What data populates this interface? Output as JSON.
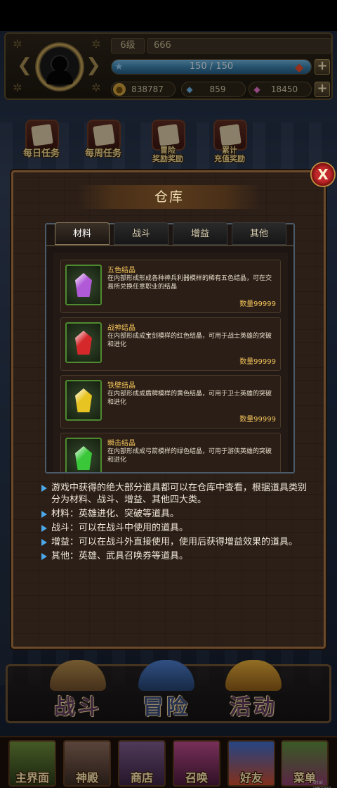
{
  "header": {
    "level": "6级",
    "player_name": "666",
    "stamina": {
      "text": "150 / 150",
      "fraction": 1.0
    },
    "gold": "838787",
    "crystal": "859",
    "diamond": "18450"
  },
  "quests": [
    {
      "label": "每日任务"
    },
    {
      "label": "每周任务"
    },
    {
      "label": "冒险\n奖励奖励"
    },
    {
      "label": "累计\n充值奖励"
    }
  ],
  "modal": {
    "title": "仓库",
    "close_label": "X",
    "tabs": [
      "材料",
      "战斗",
      "增益",
      "其他"
    ],
    "active_tab": 0,
    "items": [
      {
        "name": "五色结晶",
        "desc": "在内部形成形成各种神兵利器模样的稀有五色结晶，可在交易所兑换任意职业的结晶",
        "qty": "数量99999",
        "color": "#b05ad8"
      },
      {
        "name": "战神结晶",
        "desc": "在内部形成成宝剑模样的红色结晶，可用于战士英雄的突破和进化",
        "qty": "数量99999",
        "color": "#d4282a"
      },
      {
        "name": "铁壁结晶",
        "desc": "在内部形成成盾牌模样的黄色结晶，可用于卫士英雄的突破和进化",
        "qty": "数量99999",
        "color": "#e8c422"
      },
      {
        "name": "瞬击结晶",
        "desc": "在内部形成成弓箭模样的绿色结晶，可用于游侠英雄的突破和进化",
        "qty": "",
        "color": "#3ac83a"
      }
    ],
    "help": [
      "游戏中获得的绝大部分道具都可以在仓库中查看，根据道具类别分为材料、战斗、增益、其他四大类。",
      "材料：英雄进化、突破等道具。",
      "战斗：可以在战斗中使用的道具。",
      "增益：可以在战斗外直接使用，使用后获得增益效果的道具。",
      "其他：英雄、武具召唤券等道具。"
    ]
  },
  "big_nav": [
    {
      "label": "战斗"
    },
    {
      "label": "冒险"
    },
    {
      "label": "活动"
    }
  ],
  "tabbar": [
    {
      "label": "主界面"
    },
    {
      "label": "神殿"
    },
    {
      "label": "商店"
    },
    {
      "label": "召唤"
    },
    {
      "label": "好友"
    },
    {
      "label": "菜单"
    }
  ],
  "watermark": "trial version"
}
